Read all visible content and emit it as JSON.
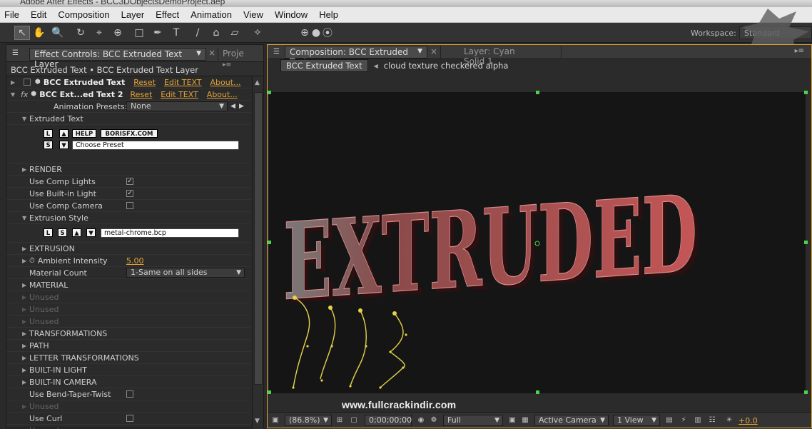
{
  "window": {
    "title": "Adobe After Effects - BCC3DObjectsDemoProject.aep"
  },
  "menubar": {
    "items": [
      "File",
      "Edit",
      "Composition",
      "Layer",
      "Effect",
      "Animation",
      "View",
      "Window",
      "Help"
    ]
  },
  "toolbar": {
    "workspace_label": "Workspace:",
    "workspace_value": "Standard"
  },
  "effect_panel": {
    "tab_label": "Effect Controls: BCC Extruded Text Layer",
    "project_tab": "Proje",
    "breadcrumb": "BCC Extruded Text • BCC Extruded Text Layer",
    "effect1": {
      "name": "BCC Extruded Text",
      "reset": "Reset",
      "edit": "Edit TEXT",
      "about": "About..."
    },
    "effect2": {
      "name": "BCC Ext...ed Text 2",
      "reset": "Reset",
      "edit": "Edit TEXT",
      "about": "About..."
    },
    "animation_presets_label": "Animation Presets:",
    "animation_presets_value": "None",
    "extruded_text_label": "Extruded Text",
    "btn_l": "L",
    "btn_up": "▲",
    "btn_help": "HELP",
    "btn_borisfx": "BORISFX.COM",
    "btn_s": "S",
    "btn_down": "▼",
    "choose_preset": "Choose Preset",
    "render": "RENDER",
    "use_comp_lights": "Use Comp Lights",
    "use_builtin_light": "Use Built-in Light",
    "use_comp_camera": "Use Comp Camera",
    "extrusion_style": "Extrusion Style",
    "extrusion_file": "metal-chrome.bcp",
    "extrusion": "EXTRUSION",
    "ambient_intensity": "Ambient Intensity",
    "ambient_value": "5.00",
    "material_count": "Material Count",
    "material_count_value": "1-Same on all sides",
    "material": "MATERIAL",
    "unused": "Unused",
    "transformations": "TRANSFORMATIONS",
    "path": "PATH",
    "letter_transformations": "LETTER TRANSFORMATIONS",
    "builtin_light": "BUILT-IN LIGHT",
    "builtin_camera": "BUILT-IN CAMERA",
    "use_bend": "Use Bend-Taper-Twist",
    "use_curl": "Use Curl"
  },
  "comp_panel": {
    "tab_label": "Composition: BCC Extruded Text",
    "layer_tab": "Layer: Cyan Solid 1",
    "crumb_active": "BCC Extruded Text",
    "crumb_next": "cloud texture checkered alpha",
    "viewer_text": "EXTRUDED",
    "watermark": "www.fullcrackindir.com",
    "zoom": "(86.8%)",
    "timecode": "0;00;00;00",
    "resolution": "Full",
    "camera": "Active Camera",
    "views": "1 View",
    "exposure": "+0.0"
  },
  "colors": {
    "accent": "#e0a63a",
    "link": "#e3a43a",
    "handle": "#4bd24b"
  }
}
